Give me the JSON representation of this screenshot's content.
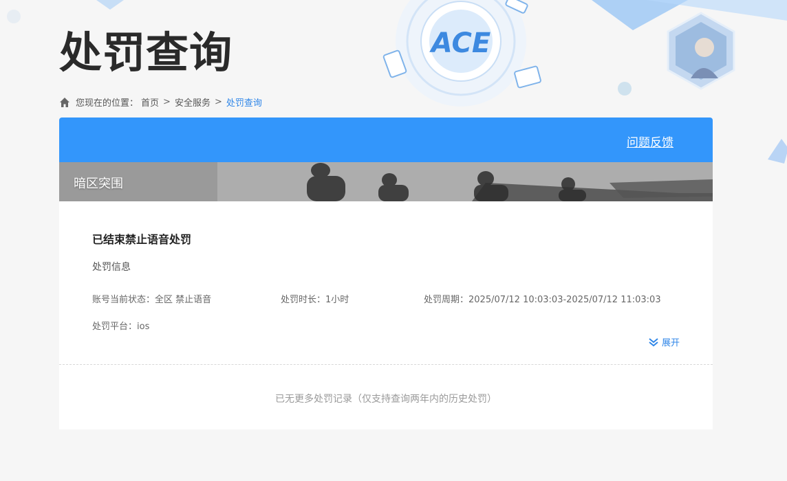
{
  "page": {
    "title": "处罚查询"
  },
  "breadcrumb": {
    "prefix": "您现在的位置：",
    "items": [
      "首页",
      "安全服务",
      "处罚查询"
    ],
    "separator": ">"
  },
  "header_card": {
    "feedback_label": "问题反馈",
    "accent_color": "#3396fb"
  },
  "game": {
    "name": "暗区突围"
  },
  "record": {
    "title": "已结束禁止语音处罚",
    "section_label": "处罚信息",
    "status_label": "账号当前状态：",
    "status_value": "全区 禁止语音",
    "duration_label": "处罚时长：",
    "duration_value": "1小时",
    "period_label": "处罚周期：",
    "period_value": "2025/07/12 10:03:03-2025/07/12 11:03:03",
    "platform_label": "处罚平台：",
    "platform_value": "ios",
    "expand_label": "展开"
  },
  "footer": {
    "no_more_text": "已无更多处罚记录（仅支持查询两年内的历史处罚）"
  },
  "icons": {
    "home": "home-icon",
    "expand": "double-chevron-down-icon",
    "logo": "ace-logo-icon"
  }
}
